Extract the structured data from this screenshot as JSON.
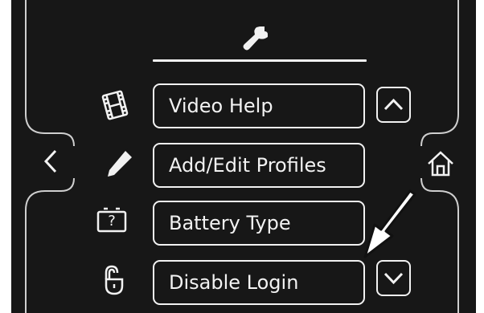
{
  "screen": {
    "title_icon": "wrench-icon",
    "menu": [
      {
        "label": "Video Help",
        "icon": "film-icon"
      },
      {
        "label": "Add/Edit Profiles",
        "icon": "pencil-icon"
      },
      {
        "label": "Battery Type",
        "icon": "battery-question-icon",
        "icon_text": "?"
      },
      {
        "label": "Disable Login",
        "icon": "lock-icon"
      }
    ],
    "controls": {
      "scroll_up": "chevron-up-icon",
      "scroll_down": "chevron-down-icon",
      "back": "chevron-left-icon",
      "home": "home-icon"
    },
    "annotation": {
      "pointer": "callout-arrow",
      "color": "#ffffff"
    }
  }
}
